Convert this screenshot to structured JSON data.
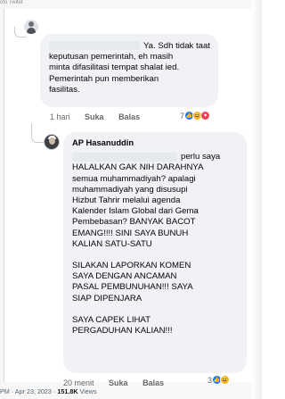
{
  "caption_top": "oto Twitet",
  "comment1": {
    "lines": [
      "Ya. Sdh tidak taat",
      "keputusan pemerintah, eh masih",
      "minta difasilitasi tempat shalat ied.",
      "Pemerintah pun memberikan",
      "fasilitas."
    ],
    "time": "1 hari",
    "like": "Suka",
    "reply": "Balas",
    "reaction_count": "7",
    "reactions": [
      "like-icon",
      "haha-icon",
      "love-icon"
    ]
  },
  "comment2": {
    "author": "AP Hasanuddin",
    "first_fragment": "perlu saya",
    "lines": [
      "HALALKAN GAK NIH DARAHNYA",
      "semua muhammadiyah? apalagi",
      "muhammadiyah yang disusupi",
      "Hizbut Tahrir melalui agenda",
      "Kalender Islam Global dari Gema",
      "Pembebasan? BANYAK BACOT",
      "EMANG!!!! SINI SAYA BUNUH",
      "KALIAN SATU-SATU"
    ],
    "lines2": [
      "SILAKAN LAPORKAN KOMEN",
      "SAYA DENGAN ANCAMAN",
      "PASAL PEMBUNUHAN!!! SAYA",
      "SIAP DIPENJARA"
    ],
    "lines3": [
      "SAYA CAPEK LIHAT",
      "PERGADUHAN KALIAN!!!"
    ],
    "time": "20 menit",
    "like": "Suka",
    "reply": "Balas",
    "reaction_count": "3",
    "reactions": [
      "like-icon",
      "haha-icon"
    ]
  },
  "tweet_footer": {
    "time": "PM · Apr 23, 2023 · ",
    "views": "151.8K",
    "views_label": " Views"
  }
}
